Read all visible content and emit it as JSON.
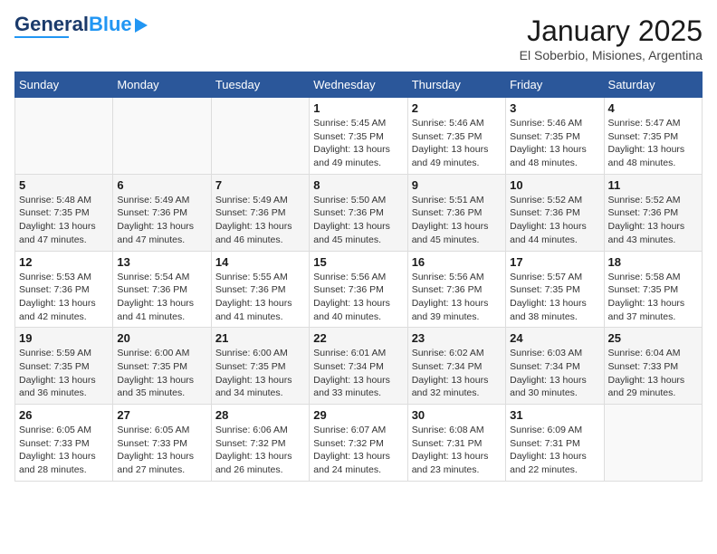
{
  "logo": {
    "text_general": "General",
    "text_blue": "Blue"
  },
  "title": "January 2025",
  "subtitle": "El Soberbio, Misiones, Argentina",
  "weekdays": [
    "Sunday",
    "Monday",
    "Tuesday",
    "Wednesday",
    "Thursday",
    "Friday",
    "Saturday"
  ],
  "weeks": [
    [
      {
        "day": "",
        "sunrise": "",
        "sunset": "",
        "daylight": ""
      },
      {
        "day": "",
        "sunrise": "",
        "sunset": "",
        "daylight": ""
      },
      {
        "day": "",
        "sunrise": "",
        "sunset": "",
        "daylight": ""
      },
      {
        "day": "1",
        "sunrise": "Sunrise: 5:45 AM",
        "sunset": "Sunset: 7:35 PM",
        "daylight": "Daylight: 13 hours and 49 minutes."
      },
      {
        "day": "2",
        "sunrise": "Sunrise: 5:46 AM",
        "sunset": "Sunset: 7:35 PM",
        "daylight": "Daylight: 13 hours and 49 minutes."
      },
      {
        "day": "3",
        "sunrise": "Sunrise: 5:46 AM",
        "sunset": "Sunset: 7:35 PM",
        "daylight": "Daylight: 13 hours and 48 minutes."
      },
      {
        "day": "4",
        "sunrise": "Sunrise: 5:47 AM",
        "sunset": "Sunset: 7:35 PM",
        "daylight": "Daylight: 13 hours and 48 minutes."
      }
    ],
    [
      {
        "day": "5",
        "sunrise": "Sunrise: 5:48 AM",
        "sunset": "Sunset: 7:35 PM",
        "daylight": "Daylight: 13 hours and 47 minutes."
      },
      {
        "day": "6",
        "sunrise": "Sunrise: 5:49 AM",
        "sunset": "Sunset: 7:36 PM",
        "daylight": "Daylight: 13 hours and 47 minutes."
      },
      {
        "day": "7",
        "sunrise": "Sunrise: 5:49 AM",
        "sunset": "Sunset: 7:36 PM",
        "daylight": "Daylight: 13 hours and 46 minutes."
      },
      {
        "day": "8",
        "sunrise": "Sunrise: 5:50 AM",
        "sunset": "Sunset: 7:36 PM",
        "daylight": "Daylight: 13 hours and 45 minutes."
      },
      {
        "day": "9",
        "sunrise": "Sunrise: 5:51 AM",
        "sunset": "Sunset: 7:36 PM",
        "daylight": "Daylight: 13 hours and 45 minutes."
      },
      {
        "day": "10",
        "sunrise": "Sunrise: 5:52 AM",
        "sunset": "Sunset: 7:36 PM",
        "daylight": "Daylight: 13 hours and 44 minutes."
      },
      {
        "day": "11",
        "sunrise": "Sunrise: 5:52 AM",
        "sunset": "Sunset: 7:36 PM",
        "daylight": "Daylight: 13 hours and 43 minutes."
      }
    ],
    [
      {
        "day": "12",
        "sunrise": "Sunrise: 5:53 AM",
        "sunset": "Sunset: 7:36 PM",
        "daylight": "Daylight: 13 hours and 42 minutes."
      },
      {
        "day": "13",
        "sunrise": "Sunrise: 5:54 AM",
        "sunset": "Sunset: 7:36 PM",
        "daylight": "Daylight: 13 hours and 41 minutes."
      },
      {
        "day": "14",
        "sunrise": "Sunrise: 5:55 AM",
        "sunset": "Sunset: 7:36 PM",
        "daylight": "Daylight: 13 hours and 41 minutes."
      },
      {
        "day": "15",
        "sunrise": "Sunrise: 5:56 AM",
        "sunset": "Sunset: 7:36 PM",
        "daylight": "Daylight: 13 hours and 40 minutes."
      },
      {
        "day": "16",
        "sunrise": "Sunrise: 5:56 AM",
        "sunset": "Sunset: 7:36 PM",
        "daylight": "Daylight: 13 hours and 39 minutes."
      },
      {
        "day": "17",
        "sunrise": "Sunrise: 5:57 AM",
        "sunset": "Sunset: 7:35 PM",
        "daylight": "Daylight: 13 hours and 38 minutes."
      },
      {
        "day": "18",
        "sunrise": "Sunrise: 5:58 AM",
        "sunset": "Sunset: 7:35 PM",
        "daylight": "Daylight: 13 hours and 37 minutes."
      }
    ],
    [
      {
        "day": "19",
        "sunrise": "Sunrise: 5:59 AM",
        "sunset": "Sunset: 7:35 PM",
        "daylight": "Daylight: 13 hours and 36 minutes."
      },
      {
        "day": "20",
        "sunrise": "Sunrise: 6:00 AM",
        "sunset": "Sunset: 7:35 PM",
        "daylight": "Daylight: 13 hours and 35 minutes."
      },
      {
        "day": "21",
        "sunrise": "Sunrise: 6:00 AM",
        "sunset": "Sunset: 7:35 PM",
        "daylight": "Daylight: 13 hours and 34 minutes."
      },
      {
        "day": "22",
        "sunrise": "Sunrise: 6:01 AM",
        "sunset": "Sunset: 7:34 PM",
        "daylight": "Daylight: 13 hours and 33 minutes."
      },
      {
        "day": "23",
        "sunrise": "Sunrise: 6:02 AM",
        "sunset": "Sunset: 7:34 PM",
        "daylight": "Daylight: 13 hours and 32 minutes."
      },
      {
        "day": "24",
        "sunrise": "Sunrise: 6:03 AM",
        "sunset": "Sunset: 7:34 PM",
        "daylight": "Daylight: 13 hours and 30 minutes."
      },
      {
        "day": "25",
        "sunrise": "Sunrise: 6:04 AM",
        "sunset": "Sunset: 7:33 PM",
        "daylight": "Daylight: 13 hours and 29 minutes."
      }
    ],
    [
      {
        "day": "26",
        "sunrise": "Sunrise: 6:05 AM",
        "sunset": "Sunset: 7:33 PM",
        "daylight": "Daylight: 13 hours and 28 minutes."
      },
      {
        "day": "27",
        "sunrise": "Sunrise: 6:05 AM",
        "sunset": "Sunset: 7:33 PM",
        "daylight": "Daylight: 13 hours and 27 minutes."
      },
      {
        "day": "28",
        "sunrise": "Sunrise: 6:06 AM",
        "sunset": "Sunset: 7:32 PM",
        "daylight": "Daylight: 13 hours and 26 minutes."
      },
      {
        "day": "29",
        "sunrise": "Sunrise: 6:07 AM",
        "sunset": "Sunset: 7:32 PM",
        "daylight": "Daylight: 13 hours and 24 minutes."
      },
      {
        "day": "30",
        "sunrise": "Sunrise: 6:08 AM",
        "sunset": "Sunset: 7:31 PM",
        "daylight": "Daylight: 13 hours and 23 minutes."
      },
      {
        "day": "31",
        "sunrise": "Sunrise: 6:09 AM",
        "sunset": "Sunset: 7:31 PM",
        "daylight": "Daylight: 13 hours and 22 minutes."
      },
      {
        "day": "",
        "sunrise": "",
        "sunset": "",
        "daylight": ""
      }
    ]
  ]
}
